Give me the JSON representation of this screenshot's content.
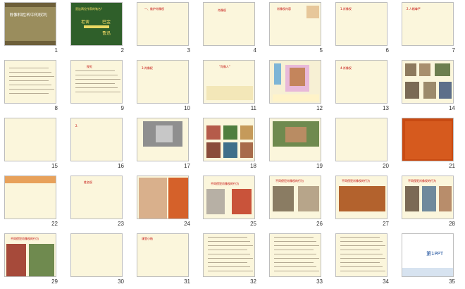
{
  "slides": [
    {
      "num": "1",
      "bg": "#9a8d5d",
      "lines": [
        {
          "text": "肖像和姓名中的权利",
          "color": "#ffffff",
          "x": 6,
          "y": 14,
          "size": 6
        }
      ]
    },
    {
      "num": "2",
      "bg": "#2f5f2a",
      "lines": [
        {
          "text": "是这两位作家的笔名？",
          "color": "#ffe36b",
          "x": 6,
          "y": 6
        },
        {
          "text": "老舍",
          "color": "#ffe36b",
          "x": 14,
          "y": 24,
          "size": 6
        },
        {
          "text": "巴金",
          "color": "#ffe36b",
          "x": 44,
          "y": 24,
          "size": 6
        },
        {
          "text": "鲁迅",
          "color": "#ffe36b",
          "x": 44,
          "y": 40,
          "size": 6
        }
      ]
    },
    {
      "num": "3",
      "bg": "#fbf6dc",
      "lines": [
        {
          "text": "一、维护肖像权",
          "color": "#c00000",
          "x": 10,
          "y": 6
        }
      ]
    },
    {
      "num": "4",
      "bg": "#fbf6dc",
      "lines": [
        {
          "text": "肖像权",
          "color": "#c00000",
          "x": 20,
          "y": 8
        }
      ]
    },
    {
      "num": "5",
      "bg": "#fbf6dc",
      "lines": [
        {
          "text": "肖像权内容",
          "color": "#c00000",
          "x": 10,
          "y": 6
        }
      ]
    },
    {
      "num": "6",
      "bg": "#fbf6dc",
      "lines": [
        {
          "text": "1.肖像权",
          "color": "#c00000",
          "x": 6,
          "y": 6
        }
      ]
    },
    {
      "num": "7",
      "bg": "#fbf6dc",
      "lines": [
        {
          "text": "2.人格尊严",
          "color": "#c00000",
          "x": 6,
          "y": 6
        }
      ]
    },
    {
      "num": "8",
      "bg": "#fbf6dc",
      "lines": []
    },
    {
      "num": "9",
      "bg": "#fbf6dc",
      "lines": [
        {
          "text": "探究",
          "color": "#c00000",
          "x": 22,
          "y": 6
        }
      ]
    },
    {
      "num": "10",
      "bg": "#fbf6dc",
      "lines": [
        {
          "text": "3.肖像权",
          "color": "#c00000",
          "x": 6,
          "y": 8
        }
      ]
    },
    {
      "num": "11",
      "bg": "#fbf6dc",
      "lines": [
        {
          "text": "\"肖像人\"",
          "color": "#c00000",
          "x": 22,
          "y": 6
        }
      ]
    },
    {
      "num": "12",
      "bg": "#f7f0d4",
      "lines": []
    },
    {
      "num": "13",
      "bg": "#fbf6dc",
      "lines": [
        {
          "text": "4.肖像权",
          "color": "#c00000",
          "x": 6,
          "y": 8
        }
      ]
    },
    {
      "num": "14",
      "bg": "#fbf6dc",
      "lines": []
    },
    {
      "num": "15",
      "bg": "#fbf6dc",
      "lines": []
    },
    {
      "num": "16",
      "bg": "#fbf6dc",
      "lines": [
        {
          "text": "2.",
          "color": "#c00000",
          "x": 6,
          "y": 8
        }
      ]
    },
    {
      "num": "17",
      "bg": "#fbf6dc",
      "lines": []
    },
    {
      "num": "18",
      "bg": "#fbf6dc",
      "lines": []
    },
    {
      "num": "19",
      "bg": "#fbf6dc",
      "lines": []
    },
    {
      "num": "20",
      "bg": "#fbf6dc",
      "lines": []
    },
    {
      "num": "21",
      "bg": "#c84a12",
      "lines": []
    },
    {
      "num": "22",
      "bg": "#fbf6dc",
      "lines": []
    },
    {
      "num": "23",
      "bg": "#fbf6dc",
      "lines": [
        {
          "text": "姓名权",
          "color": "#c00000",
          "x": 18,
          "y": 6
        }
      ]
    },
    {
      "num": "24",
      "bg": "#fbf6dc",
      "lines": []
    },
    {
      "num": "25",
      "bg": "#fbf6dc",
      "lines": [
        {
          "text": "不同侵犯肖像权的行为",
          "color": "#c00000",
          "x": 10,
          "y": 8
        }
      ]
    },
    {
      "num": "26",
      "bg": "#fbf6dc",
      "lines": [
        {
          "text": "不同侵犯肖像权的行为",
          "color": "#c00000",
          "x": 8,
          "y": 4
        }
      ]
    },
    {
      "num": "27",
      "bg": "#fbf6dc",
      "lines": [
        {
          "text": "不同侵犯肖像权的行为",
          "color": "#c00000",
          "x": 8,
          "y": 4
        }
      ]
    },
    {
      "num": "28",
      "bg": "#fbf6dc",
      "lines": [
        {
          "text": "不同侵犯肖像权的行为",
          "color": "#c00000",
          "x": 8,
          "y": 4
        }
      ]
    },
    {
      "num": "29",
      "bg": "#fbf6dc",
      "lines": [
        {
          "text": "不同侵犯肖像权的行为",
          "color": "#c00000",
          "x": 8,
          "y": 4
        }
      ]
    },
    {
      "num": "30",
      "bg": "#fbf6dc",
      "lines": []
    },
    {
      "num": "31",
      "bg": "#fbf6dc",
      "lines": [
        {
          "text": "课堂小结",
          "color": "#c00000",
          "x": 6,
          "y": 4
        }
      ]
    },
    {
      "num": "32",
      "bg": "#fbf6dc",
      "lines": []
    },
    {
      "num": "33",
      "bg": "#fbf6dc",
      "lines": []
    },
    {
      "num": "34",
      "bg": "#fbf6dc",
      "lines": []
    },
    {
      "num": "35",
      "bg": "#ffffff",
      "lines": [
        {
          "text": "第1PPT",
          "color": "#1b4f9c",
          "x": 34,
          "y": 24,
          "size": 7
        }
      ]
    }
  ]
}
